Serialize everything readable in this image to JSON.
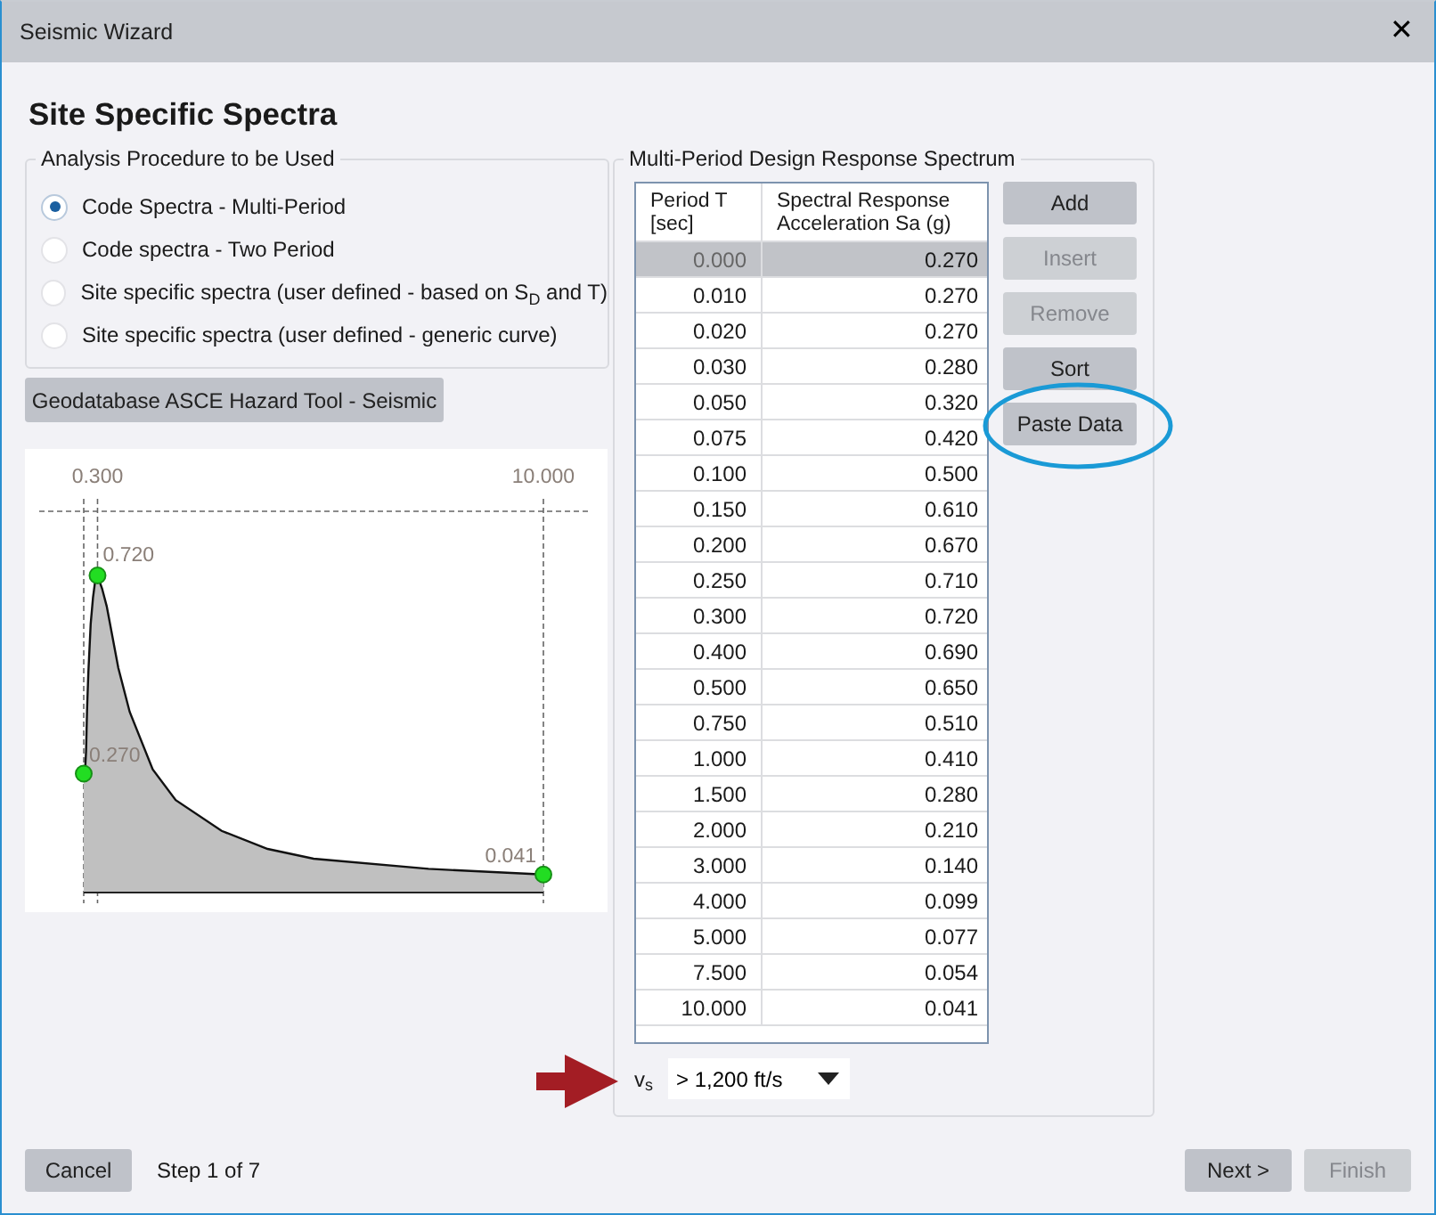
{
  "window": {
    "title": "Seismic Wizard",
    "close": "✕"
  },
  "heading": "Site Specific Spectra",
  "procedure": {
    "title": "Analysis Procedure to be Used",
    "options": [
      {
        "label": "Code Spectra - Multi-Period",
        "selected": true
      },
      {
        "label": "Code spectra - Two Period",
        "selected": false
      },
      {
        "label": "Site specific spectra (user defined - based on S$_{D}$ and T)",
        "selected": false
      },
      {
        "label": "Site specific spectra (user defined - generic curve)",
        "selected": false
      }
    ]
  },
  "hazard_button": "Geodatabase ASCE Hazard Tool - Seismic",
  "plot": {
    "tick_labels": [
      "0.300",
      "10.000"
    ],
    "point_labels": [
      "0.270",
      "0.720",
      "0.041"
    ]
  },
  "spectrum": {
    "title": "Multi-Period Design Response Spectrum",
    "columns": [
      "Period T\n[sec]",
      "Spectral Response\nAcceleration Sa (g)"
    ],
    "rows": [
      {
        "period": "0.000",
        "sa": "0.270",
        "selected": true
      },
      {
        "period": "0.010",
        "sa": "0.270",
        "selected": false
      },
      {
        "period": "0.020",
        "sa": "0.270",
        "selected": false
      },
      {
        "period": "0.030",
        "sa": "0.280",
        "selected": false
      },
      {
        "period": "0.050",
        "sa": "0.320",
        "selected": false
      },
      {
        "period": "0.075",
        "sa": "0.420",
        "selected": false
      },
      {
        "period": "0.100",
        "sa": "0.500",
        "selected": false
      },
      {
        "period": "0.150",
        "sa": "0.610",
        "selected": false
      },
      {
        "period": "0.200",
        "sa": "0.670",
        "selected": false
      },
      {
        "period": "0.250",
        "sa": "0.710",
        "selected": false
      },
      {
        "period": "0.300",
        "sa": "0.720",
        "selected": false
      },
      {
        "period": "0.400",
        "sa": "0.690",
        "selected": false
      },
      {
        "period": "0.500",
        "sa": "0.650",
        "selected": false
      },
      {
        "period": "0.750",
        "sa": "0.510",
        "selected": false
      },
      {
        "period": "1.000",
        "sa": "0.410",
        "selected": false
      },
      {
        "period": "1.500",
        "sa": "0.280",
        "selected": false
      },
      {
        "period": "2.000",
        "sa": "0.210",
        "selected": false
      },
      {
        "period": "3.000",
        "sa": "0.140",
        "selected": false
      },
      {
        "period": "4.000",
        "sa": "0.099",
        "selected": false
      },
      {
        "period": "5.000",
        "sa": "0.077",
        "selected": false
      },
      {
        "period": "7.500",
        "sa": "0.054",
        "selected": false
      },
      {
        "period": "10.000",
        "sa": "0.041",
        "selected": false
      }
    ],
    "buttons": [
      {
        "label": "Add",
        "disabled": false
      },
      {
        "label": "Insert",
        "disabled": true
      },
      {
        "label": "Remove",
        "disabled": true
      },
      {
        "label": "Sort",
        "disabled": false
      },
      {
        "label": "Paste Data",
        "disabled": false,
        "highlighted": true
      }
    ],
    "vs_label": "v$_{s}$",
    "vs_value": "> 1,200 ft/s"
  },
  "footer": {
    "cancel": "Cancel",
    "step": "Step 1 of 7",
    "buttons": [
      {
        "label": "Next >",
        "disabled": false
      },
      {
        "label": "Finish",
        "disabled": true
      }
    ]
  }
}
